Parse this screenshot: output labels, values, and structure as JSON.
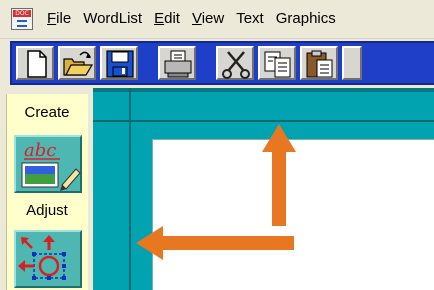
{
  "menubar": {
    "app_icon": "document-app-icon",
    "items": [
      {
        "label": "File",
        "underline": "F",
        "rest": "ile"
      },
      {
        "label": "WordList",
        "underline": "",
        "rest": "WordList"
      },
      {
        "label": "Edit",
        "underline": "E",
        "rest": "dit"
      },
      {
        "label": "View",
        "underline": "V",
        "rest": "iew"
      },
      {
        "label": "Text",
        "underline": "",
        "rest": "Text"
      },
      {
        "label": "Graphics",
        "underline": "",
        "rest": "Graphics"
      }
    ]
  },
  "toolbar": {
    "buttons": [
      "new-document-icon",
      "open-folder-icon",
      "save-disk-icon",
      "print-icon",
      "cut-scissors-icon",
      "copy-icon",
      "paste-clipboard-icon"
    ]
  },
  "leftpanel": {
    "create_label": "Create",
    "create_tool_text": "abc",
    "adjust_label": "Adjust"
  },
  "colors": {
    "workspace": "#00a3af",
    "toolbar": "#1f3fc8",
    "panel": "#ffffcc",
    "arrow": "#e87722"
  }
}
